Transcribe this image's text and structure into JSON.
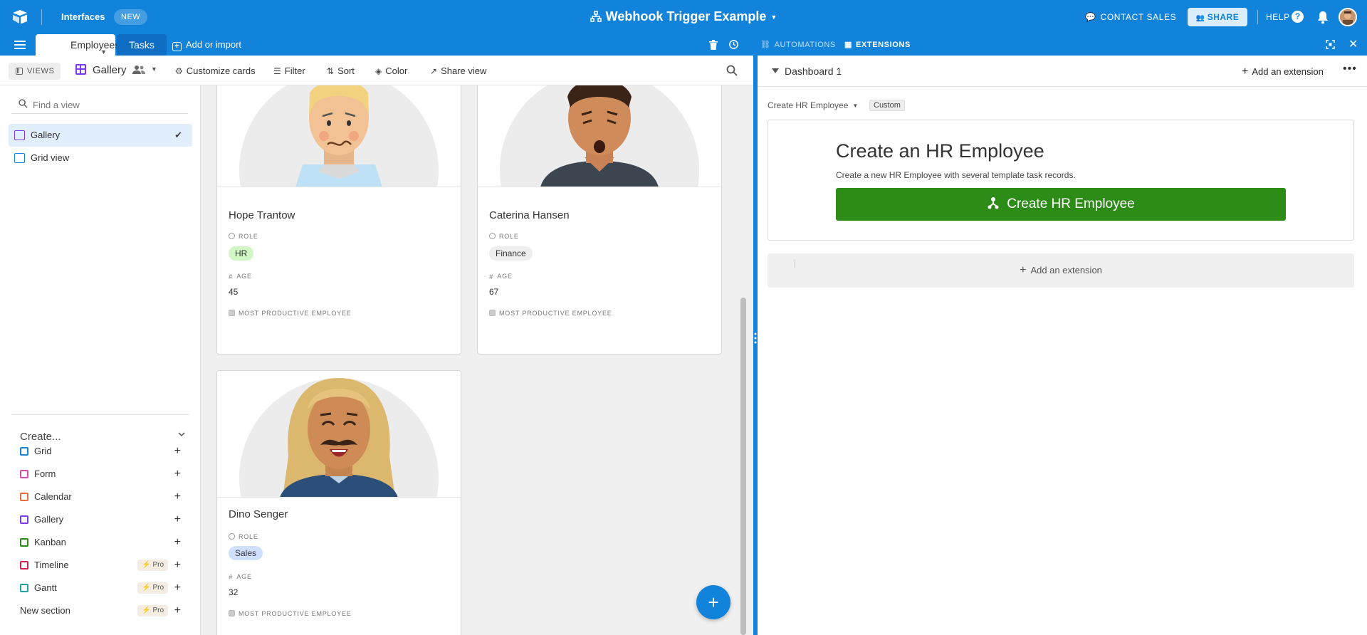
{
  "topbar": {
    "app_label": "Interfaces",
    "new_badge": "NEW",
    "base_title": "Webhook Trigger Example",
    "contact_sales": "CONTACT SALES",
    "share": "SHARE",
    "help": "HELP"
  },
  "tables": {
    "active": "Employees",
    "other": "Tasks",
    "add_or_import": "Add or import"
  },
  "toolbar": {
    "views_button": "VIEWS",
    "view_name": "Gallery",
    "customize_cards": "Customize cards",
    "filter": "Filter",
    "sort": "Sort",
    "color": "Color",
    "share_view": "Share view"
  },
  "sidebar": {
    "find_placeholder": "Find a view",
    "views": [
      {
        "label": "Gallery",
        "type": "gallery",
        "selected": true
      },
      {
        "label": "Grid view",
        "type": "grid",
        "selected": false
      }
    ],
    "create_header": "Create...",
    "create_items": [
      {
        "label": "Grid",
        "color": "#1283da",
        "pro": ""
      },
      {
        "label": "Form",
        "color": "#d54fb3",
        "pro": ""
      },
      {
        "label": "Calendar",
        "color": "#e86d38",
        "pro": ""
      },
      {
        "label": "Gallery",
        "color": "#7c39ed",
        "pro": ""
      },
      {
        "label": "Kanban",
        "color": "#2d8b17",
        "pro": ""
      },
      {
        "label": "Timeline",
        "color": "#d3224c",
        "pro": "Pro"
      },
      {
        "label": "Gantt",
        "color": "#20a3a3",
        "pro": "Pro"
      },
      {
        "label": "New section",
        "color": "",
        "pro": "Pro"
      }
    ]
  },
  "cards": [
    {
      "name": "Hope Trantow",
      "role_label": "ROLE",
      "role": "HR",
      "role_color": "#d1f7c4",
      "age_label": "AGE",
      "age": "45",
      "mpe_label": "MOST PRODUCTIVE EMPLOYEE"
    },
    {
      "name": "Caterina Hansen",
      "role_label": "ROLE",
      "role": "Finance",
      "role_color": "#eeeeee",
      "age_label": "AGE",
      "age": "67",
      "mpe_label": "MOST PRODUCTIVE EMPLOYEE"
    },
    {
      "name": "Dino Senger",
      "role_label": "ROLE",
      "role": "Sales",
      "role_color": "#cfdfff",
      "age_label": "AGE",
      "age": "32",
      "mpe_label": "MOST PRODUCTIVE EMPLOYEE"
    }
  ],
  "right_pane": {
    "automations": "AUTOMATIONS",
    "extensions": "EXTENSIONS",
    "dashboard_title": "Dashboard 1",
    "add_extension": "Add an extension",
    "extension": {
      "name": "Create HR Employee",
      "badge": "Custom",
      "heading": "Create an HR Employee",
      "description": "Create a new HR Employee with several template task records.",
      "button_label": "Create HR Employee",
      "button_color": "#2d8b17"
    },
    "add_extension_bar": "Add an extension"
  },
  "colors": {
    "brand_blue": "#1283da",
    "gallery_purple": "#7c39ed"
  }
}
